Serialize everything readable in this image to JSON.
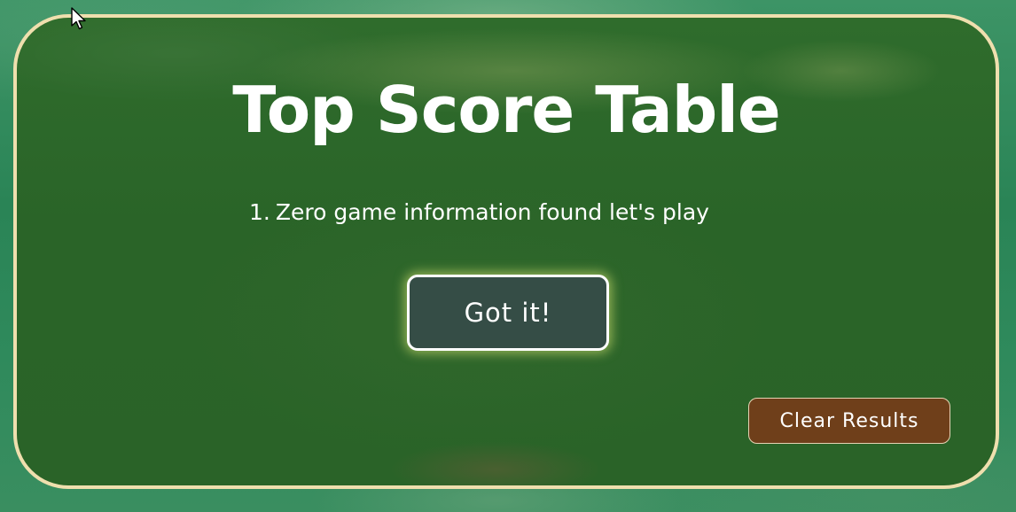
{
  "modal": {
    "title": "Top Score Table",
    "scores": [
      {
        "rank": "1.",
        "text": "Zero game information found let's play"
      }
    ],
    "got_it_label": "Got it!",
    "clear_results_label": "Clear Results"
  },
  "colors": {
    "background_green": "#2a8456",
    "modal_green": "#2a6428",
    "modal_border": "#efdfae",
    "got_it_bg": "#354d46",
    "got_it_glow": "#e6f078",
    "clear_results_bg": "#6f3f1a"
  },
  "icons": {
    "cursor": "mouse-pointer-icon"
  }
}
